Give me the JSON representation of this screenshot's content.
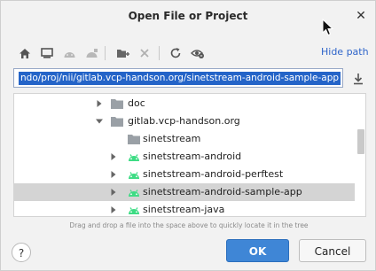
{
  "dialog": {
    "title": "Open File or Project",
    "close_glyph": "✕"
  },
  "toolbar": {
    "icons": [
      "home-icon",
      "desktop-icon",
      "android-icon",
      "android-alt-icon",
      "new-folder-icon",
      "delete-icon",
      "refresh-icon",
      "show-hidden-icon"
    ],
    "hide_path_label": "Hide path"
  },
  "path": {
    "value": "ndo/proj/nii/gitlab.vcp-handson.org/sinetstream-android-sample-app"
  },
  "tree": {
    "rows": [
      {
        "label": "doc",
        "icon": "folder-icon",
        "arrow": "right"
      },
      {
        "label": "gitlab.vcp-handson.org",
        "icon": "folder-icon",
        "arrow": "down"
      },
      {
        "label": "sinetstream",
        "icon": "folder-icon",
        "arrow": "none"
      },
      {
        "label": "sinetstream-android",
        "icon": "android-icon",
        "arrow": "right"
      },
      {
        "label": "sinetstream-android-perftest",
        "icon": "android-icon",
        "arrow": "right"
      },
      {
        "label": "sinetstream-android-sample-app",
        "icon": "android-icon",
        "arrow": "right",
        "selected": true
      },
      {
        "label": "sinetstream-java",
        "icon": "android-icon",
        "arrow": "right"
      }
    ]
  },
  "hint": "Drag and drop a file into the space above to quickly locate it in the tree",
  "buttons": {
    "help": "?",
    "ok": "OK",
    "cancel": "Cancel"
  },
  "colors": {
    "accent": "#3f86d6",
    "selection": "#2464c8",
    "android_green": "#3ddc84",
    "folder_grey": "#9aa0a6"
  }
}
